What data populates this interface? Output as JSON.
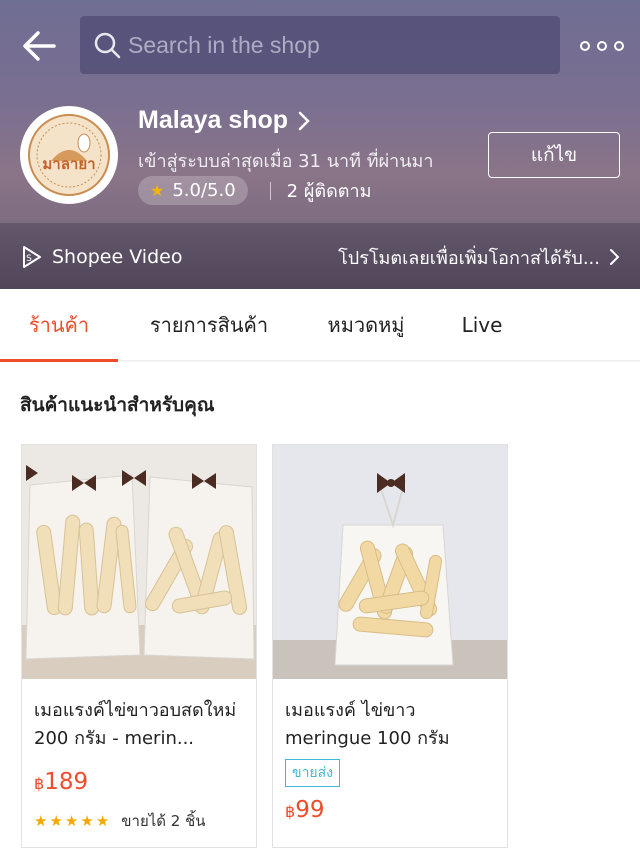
{
  "header": {
    "search_placeholder": "Search in the shop"
  },
  "shop": {
    "name": "Malaya shop",
    "status": "เข้าสู่ระบบล่าสุดเมื่อ 31 นาที ที่ผ่านมา",
    "rating": "5.0/5.0",
    "followers": "2 ผู้ติดตาม",
    "edit_label": "แก้ไข",
    "avatar_logo_text": "มาลายา"
  },
  "video_bar": {
    "label": "Shopee Video",
    "promo_text": "โปรโมตเลยเพื่อเพิ่มโอกาสได้รับ..."
  },
  "tabs": [
    {
      "label": "ร้านค้า",
      "active": true
    },
    {
      "label": "รายการสินค้า",
      "active": false
    },
    {
      "label": "หมวดหมู่",
      "active": false
    },
    {
      "label": "Live",
      "active": false
    }
  ],
  "section": {
    "title": "สินค้าแนะนำสำหรับคุณ"
  },
  "products": [
    {
      "name": "เมอแรงค์ไข่ขาวอบสดใหม่ 200 กรัม - merin...",
      "currency": "฿",
      "price": "189",
      "rating_stars": 5,
      "sold": "ขายได้ 2 ชิ้น"
    },
    {
      "name": "เมอแรงค์ ไข่ขาว meringue 100 กรัม",
      "badge": "ขายส่ง",
      "currency": "฿",
      "price": "99"
    }
  ],
  "colors": {
    "accent": "#ee4d2d",
    "star": "#f6a700",
    "badge": "#41b8d3"
  }
}
